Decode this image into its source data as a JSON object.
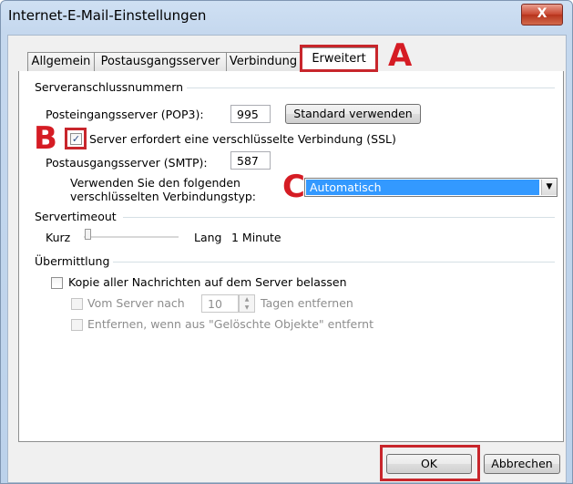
{
  "window": {
    "title": "Internet-E-Mail-Einstellungen",
    "close_glyph": "X"
  },
  "tabs": [
    {
      "label": "Allgemein"
    },
    {
      "label": "Postausgangsserver"
    },
    {
      "label": "Verbindung"
    },
    {
      "label": "Erweitert"
    }
  ],
  "markers": {
    "a": "A",
    "b": "B",
    "c": "C"
  },
  "server_ports": {
    "group_label": "Serveranschlussnummern",
    "pop3_label": "Posteingangsserver (POP3):",
    "pop3_value": "995",
    "default_button": "Standard verwenden",
    "ssl_label": "Server erfordert eine verschlüsselte Verbindung (SSL)",
    "ssl_checked": true,
    "smtp_label": "Postausgangsserver (SMTP):",
    "smtp_value": "587",
    "encryption_label_line1": "Verwenden Sie den folgenden",
    "encryption_label_line2": "verschlüsselten Verbindungstyp:",
    "encryption_value": "Automatisch"
  },
  "timeout": {
    "group_label": "Servertimeout",
    "short_label": "Kurz",
    "long_label": "Lang",
    "value_text": "1 Minute",
    "slider_level": 0.0
  },
  "delivery": {
    "group_label": "Übermittlung",
    "keep_copy_label": "Kopie aller Nachrichten auf dem Server belassen",
    "keep_copy_checked": false,
    "remove_after_label": "Vom Server nach",
    "remove_after_days": "10",
    "days_suffix": "Tagen entfernen",
    "remove_deleted_label": "Entfernen, wenn aus \"Gelöschte Objekte\" entfernt"
  },
  "footer": {
    "ok_label": "OK",
    "cancel_label": "Abbrechen"
  },
  "colors": {
    "highlight_red": "#c8262c",
    "selection_blue": "#3399ff"
  }
}
